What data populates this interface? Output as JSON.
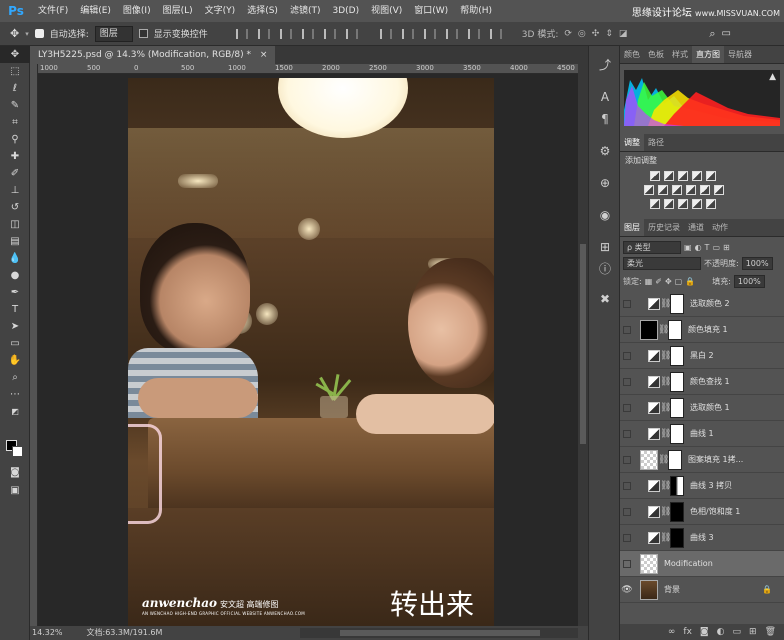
{
  "app": {
    "logo": "Ps",
    "menus": [
      "文件(F)",
      "编辑(E)",
      "图像(I)",
      "图层(L)",
      "文字(Y)",
      "选择(S)",
      "滤镜(T)",
      "3D(D)",
      "视图(V)",
      "窗口(W)",
      "帮助(H)"
    ],
    "watermark_cn": "思缘设计论坛",
    "watermark_en": "www.MISSVUAN.COM"
  },
  "options": {
    "auto_select_label": "自动选择:",
    "auto_select_value": "图层",
    "show_transform_label": "显示变换控件",
    "mode_3d_label": "3D 模式:"
  },
  "document": {
    "tab_title": "LY3H5225.psd @ 14.3% (Modification, RGB/8) *",
    "ruler_ticks": [
      "1000",
      "500",
      "0",
      "500",
      "1000",
      "1500",
      "2000",
      "2500",
      "3000",
      "3500",
      "4000",
      "4500"
    ],
    "signature": "anwenchao",
    "signature_sub": "安文超 高端修图",
    "signature_tiny": "AN WENCHAO HIGH-END GRAPHIC OFFICIAL WEBSITE ANWENCHAO.COM",
    "caption": "转出来"
  },
  "status": {
    "zoom": "14.32%",
    "doc_size": "文档:63.3M/191.6M"
  },
  "panels": {
    "top_tabs": [
      "颜色",
      "色板",
      "样式",
      "直方图",
      "导航器"
    ],
    "top_active": "直方图",
    "adj_tabs": [
      "调整",
      "路径"
    ],
    "adj_title": "添加调整",
    "layer_tabs": [
      "图层",
      "历史记录",
      "通道",
      "动作"
    ],
    "filter_kind": "ρ 类型",
    "blend_mode": "柔光",
    "opacity_label": "不透明度:",
    "opacity_value": "100%",
    "lock_label": "锁定:",
    "fill_label": "填充:",
    "fill_value": "100%"
  },
  "layers": [
    {
      "name": "选取颜色 2",
      "thumb": "adj",
      "mask": "white",
      "visible": false,
      "selected": false
    },
    {
      "name": "颜色填充 1",
      "thumb": "fill",
      "mask": "white",
      "visible": false,
      "selected": false
    },
    {
      "name": "黑白 2",
      "thumb": "adj",
      "mask": "white",
      "visible": false,
      "selected": false
    },
    {
      "name": "颜色查找 1",
      "thumb": "adj",
      "mask": "white",
      "visible": false,
      "selected": false
    },
    {
      "name": "选取颜色 1",
      "thumb": "adj",
      "mask": "white",
      "visible": false,
      "selected": false
    },
    {
      "name": "曲线 1",
      "thumb": "adj",
      "mask": "white",
      "visible": false,
      "selected": false
    },
    {
      "name": "图案填充 1拷...",
      "thumb": "pattern",
      "mask": "white",
      "visible": false,
      "selected": false
    },
    {
      "name": "曲线 3 拷贝",
      "thumb": "adj",
      "mask": "mix",
      "visible": false,
      "selected": false
    },
    {
      "name": "色相/饱和度 1",
      "thumb": "adj",
      "mask": "dark",
      "visible": false,
      "selected": false
    },
    {
      "name": "曲线 3",
      "thumb": "adj",
      "mask": "dark",
      "visible": false,
      "selected": false
    },
    {
      "name": "Modification",
      "thumb": "pattern",
      "mask": "none",
      "visible": false,
      "selected": true
    },
    {
      "name": "背景",
      "thumb": "photo",
      "mask": "none",
      "visible": true,
      "selected": false
    }
  ],
  "colors": {
    "ps_blue": "#31a8ff",
    "panel_bg": "#535353",
    "workspace_bg": "#282828"
  }
}
